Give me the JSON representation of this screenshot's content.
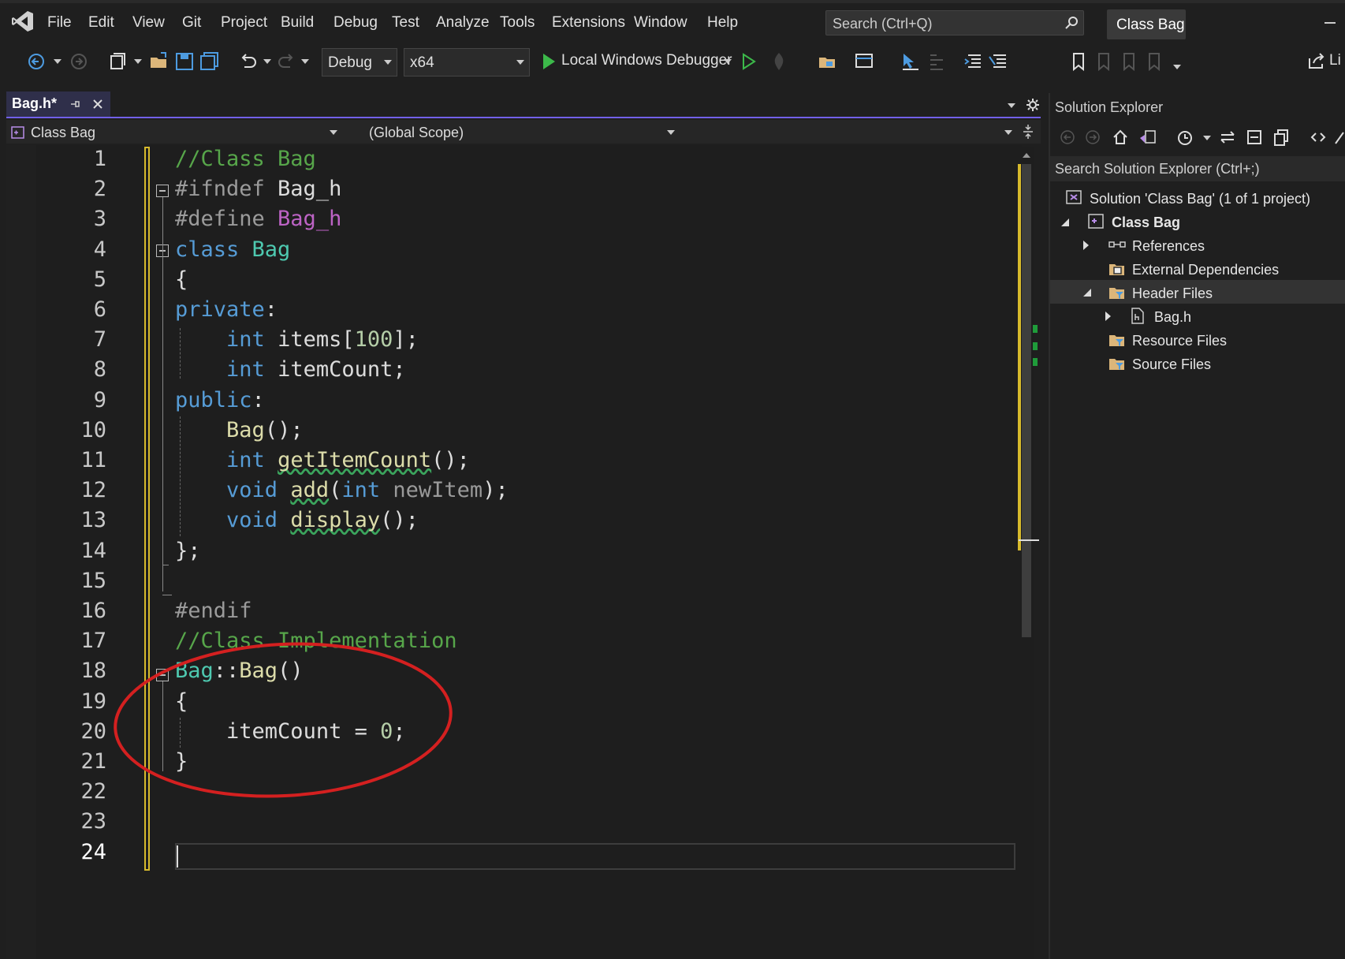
{
  "menu": {
    "items": [
      "File",
      "Edit",
      "View",
      "Git",
      "Project",
      "Build",
      "Debug",
      "Test",
      "Analyze",
      "Tools",
      "Extensions",
      "Window",
      "Help"
    ],
    "search_placeholder": "Search (Ctrl+Q)",
    "solution_title": "Class Bag"
  },
  "toolbar": {
    "configuration": "Debug",
    "platform": "x64",
    "run_label": "Local Windows Debugger",
    "live_share": "Li"
  },
  "editor": {
    "tab_title": "Bag.h*",
    "nav_project": "Class Bag",
    "nav_scope": "(Global Scope)",
    "line_numbers": [
      "1",
      "2",
      "3",
      "4",
      "5",
      "6",
      "7",
      "8",
      "9",
      "10",
      "11",
      "12",
      "13",
      "14",
      "15",
      "16",
      "17",
      "18",
      "19",
      "20",
      "21",
      "22",
      "23",
      "24"
    ],
    "lines": [
      [
        {
          "t": "//Class Bag",
          "c": "cm"
        }
      ],
      [
        {
          "t": "#ifndef ",
          "c": "pp"
        },
        {
          "t": "Bag_h",
          "c": ""
        }
      ],
      [
        {
          "t": "#define ",
          "c": "pp"
        },
        {
          "t": "Bag_h",
          "c": "mac"
        }
      ],
      [
        {
          "t": "class ",
          "c": "kw"
        },
        {
          "t": "Bag",
          "c": "ty"
        }
      ],
      [
        {
          "t": "{",
          "c": ""
        }
      ],
      [
        {
          "t": "private",
          "c": "kw"
        },
        {
          "t": ":",
          "c": ""
        }
      ],
      [
        {
          "t": "    ",
          "c": ""
        },
        {
          "t": "int ",
          "c": "kw"
        },
        {
          "t": "items[",
          "c": ""
        },
        {
          "t": "100",
          "c": "num"
        },
        {
          "t": "];",
          "c": ""
        }
      ],
      [
        {
          "t": "    ",
          "c": ""
        },
        {
          "t": "int ",
          "c": "kw"
        },
        {
          "t": "itemCount;",
          "c": ""
        }
      ],
      [
        {
          "t": "public",
          "c": "kw"
        },
        {
          "t": ":",
          "c": ""
        }
      ],
      [
        {
          "t": "    ",
          "c": ""
        },
        {
          "t": "Bag",
          "c": "fn"
        },
        {
          "t": "();",
          "c": ""
        }
      ],
      [
        {
          "t": "    ",
          "c": ""
        },
        {
          "t": "int ",
          "c": "kw"
        },
        {
          "t": "getItemCount",
          "c": "fn sq"
        },
        {
          "t": "();",
          "c": ""
        }
      ],
      [
        {
          "t": "    ",
          "c": ""
        },
        {
          "t": "void ",
          "c": "kw"
        },
        {
          "t": "add",
          "c": "fn sq"
        },
        {
          "t": "(",
          "c": ""
        },
        {
          "t": "int ",
          "c": "kw"
        },
        {
          "t": "newItem",
          "c": "par"
        },
        {
          "t": ");",
          "c": ""
        }
      ],
      [
        {
          "t": "    ",
          "c": ""
        },
        {
          "t": "void ",
          "c": "kw"
        },
        {
          "t": "display",
          "c": "fn sq"
        },
        {
          "t": "();",
          "c": ""
        }
      ],
      [
        {
          "t": "};",
          "c": ""
        }
      ],
      [],
      [
        {
          "t": "#endif",
          "c": "pp"
        }
      ],
      [
        {
          "t": "//Class Implementation",
          "c": "cm"
        }
      ],
      [
        {
          "t": "Bag",
          "c": "ty"
        },
        {
          "t": "::",
          "c": ""
        },
        {
          "t": "Bag",
          "c": "fn"
        },
        {
          "t": "()",
          "c": ""
        }
      ],
      [
        {
          "t": "{",
          "c": ""
        }
      ],
      [
        {
          "t": "    ",
          "c": ""
        },
        {
          "t": "itemCount = ",
          "c": ""
        },
        {
          "t": "0",
          "c": "num"
        },
        {
          "t": ";",
          "c": ""
        }
      ],
      [
        {
          "t": "}",
          "c": ""
        }
      ],
      [],
      [],
      []
    ]
  },
  "solution_explorer": {
    "title": "Solution Explorer",
    "search_placeholder": "Search Solution Explorer (Ctrl+;)",
    "tree": [
      {
        "label": "Solution 'Class Bag' (1 of 1 project)",
        "icon": "solution-icon",
        "bold": false
      },
      {
        "label": "Class Bag",
        "icon": "project-icon",
        "bold": true
      },
      {
        "label": "References",
        "icon": "references-icon",
        "bold": false
      },
      {
        "label": "External Dependencies",
        "icon": "external-deps-icon",
        "bold": false
      },
      {
        "label": "Header Files",
        "icon": "filter-folder-icon",
        "bold": false
      },
      {
        "label": "Bag.h",
        "icon": "header-file-icon",
        "bold": false
      },
      {
        "label": "Resource Files",
        "icon": "filter-folder-icon",
        "bold": false
      },
      {
        "label": "Source Files",
        "icon": "filter-folder-icon",
        "bold": false
      }
    ]
  },
  "colors": {
    "accent": "#7160e8",
    "annotation": "#d42020",
    "change_marker": "#d7ba2c"
  }
}
